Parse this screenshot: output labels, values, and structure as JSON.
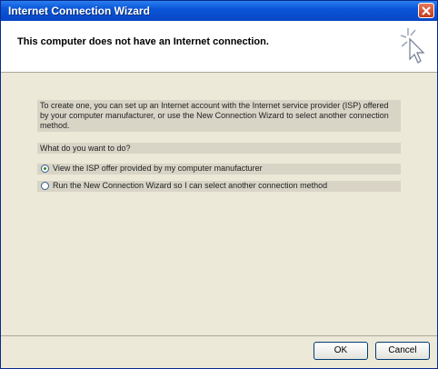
{
  "window": {
    "title": "Internet Connection Wizard"
  },
  "header": {
    "title": "This computer does not have an Internet connection."
  },
  "content": {
    "description": "To create one, you can set up an Internet account with the Internet service provider (ISP) offered by your computer manufacturer, or use the New Connection Wizard to select another connection method.",
    "question": "What do you want to do?",
    "options": [
      {
        "label": "View the ISP offer provided by my computer manufacturer",
        "selected": true
      },
      {
        "label": "Run the New Connection Wizard so I can select another connection method",
        "selected": false
      }
    ]
  },
  "buttons": {
    "ok": "OK",
    "cancel": "Cancel"
  },
  "icons": {
    "close": "close-icon",
    "wizard": "wizard-cursor-icon"
  },
  "colors": {
    "titlebar": "#0a55d8",
    "dialog_bg": "#ece9d8",
    "close_btn": "#c23b1c"
  }
}
